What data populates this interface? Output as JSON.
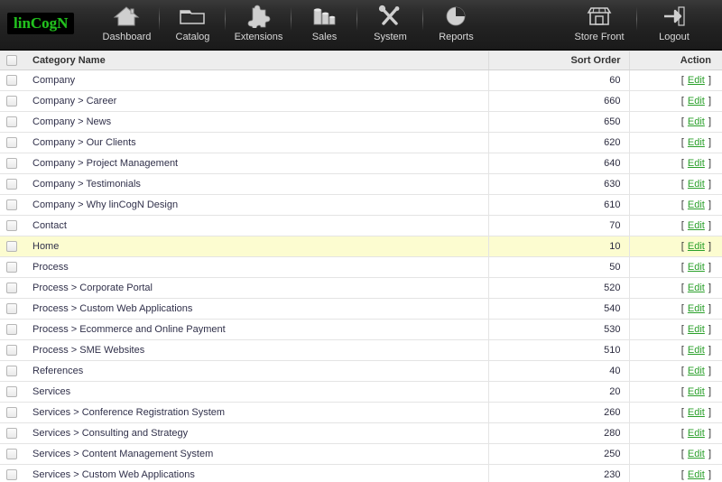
{
  "header": {
    "logo_text": "linCogN",
    "nav_left": [
      {
        "label": "Dashboard",
        "icon": "house-icon"
      },
      {
        "label": "Catalog",
        "icon": "folder-icon"
      },
      {
        "label": "Extensions",
        "icon": "puzzle-piece-icon"
      },
      {
        "label": "Sales",
        "icon": "coins-icon"
      },
      {
        "label": "System",
        "icon": "tools-icon"
      },
      {
        "label": "Reports",
        "icon": "pie-chart-icon"
      }
    ],
    "nav_right": [
      {
        "label": "Store Front",
        "icon": "storefront-icon"
      },
      {
        "label": "Logout",
        "icon": "logout-arrow-icon"
      }
    ]
  },
  "table": {
    "columns": [
      "",
      "Category Name",
      "Sort Order",
      "Action"
    ],
    "action_label": "Edit",
    "bracket_open": "[",
    "bracket_close": "]",
    "rows": [
      {
        "name": "Company",
        "sort": "60",
        "highlight": false
      },
      {
        "name": "Company > Career",
        "sort": "660",
        "highlight": false
      },
      {
        "name": "Company > News",
        "sort": "650",
        "highlight": false
      },
      {
        "name": "Company > Our Clients",
        "sort": "620",
        "highlight": false
      },
      {
        "name": "Company > Project Management",
        "sort": "640",
        "highlight": false
      },
      {
        "name": "Company > Testimonials",
        "sort": "630",
        "highlight": false
      },
      {
        "name": "Company > Why linCogN Design",
        "sort": "610",
        "highlight": false
      },
      {
        "name": "Contact",
        "sort": "70",
        "highlight": false
      },
      {
        "name": "Home",
        "sort": "10",
        "highlight": true
      },
      {
        "name": "Process",
        "sort": "50",
        "highlight": false
      },
      {
        "name": "Process > Corporate Portal",
        "sort": "520",
        "highlight": false
      },
      {
        "name": "Process > Custom Web Applications",
        "sort": "540",
        "highlight": false
      },
      {
        "name": "Process > Ecommerce and Online Payment",
        "sort": "530",
        "highlight": false
      },
      {
        "name": "Process > SME Websites",
        "sort": "510",
        "highlight": false
      },
      {
        "name": "References",
        "sort": "40",
        "highlight": false
      },
      {
        "name": "Services",
        "sort": "20",
        "highlight": false
      },
      {
        "name": "Services > Conference Registration System",
        "sort": "260",
        "highlight": false
      },
      {
        "name": "Services > Consulting and Strategy",
        "sort": "280",
        "highlight": false
      },
      {
        "name": "Services > Content Management System",
        "sort": "250",
        "highlight": false
      },
      {
        "name": "Services > Custom Web Applications",
        "sort": "230",
        "highlight": false
      }
    ]
  },
  "colors": {
    "logo_green": "#22c11e",
    "edit_link_green": "#2aa02a",
    "header_bar_dark": "#222222",
    "row_highlight_yellow": "#fcfcd0",
    "table_header_gray": "#ededed"
  }
}
